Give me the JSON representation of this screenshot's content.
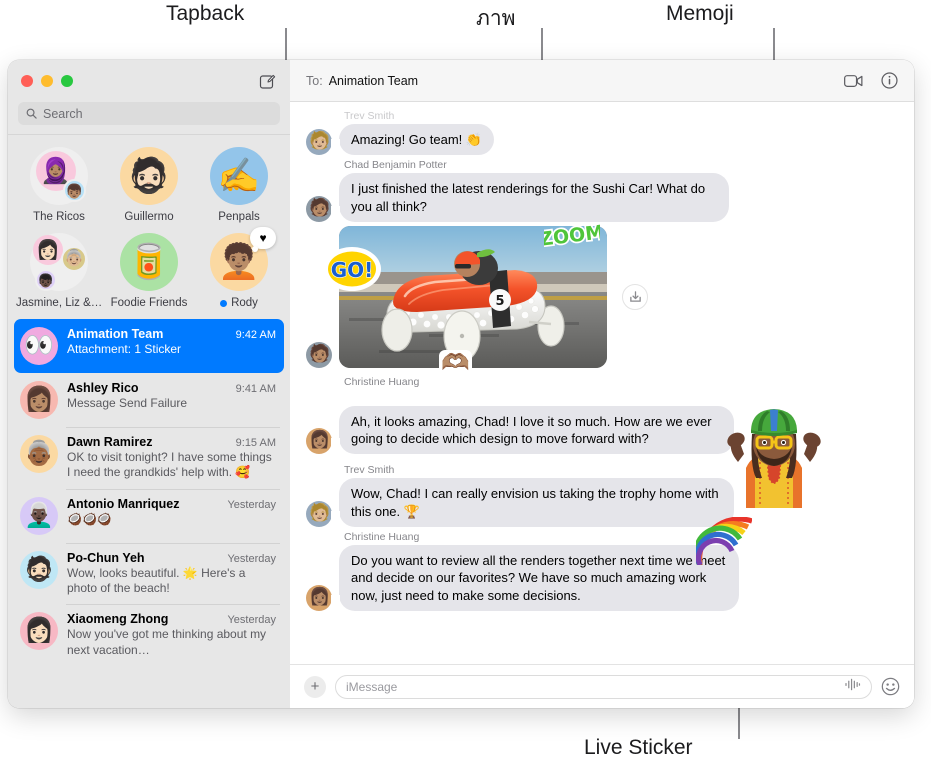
{
  "annotations": [
    {
      "id": "tapback",
      "label": "Tapback"
    },
    {
      "id": "image",
      "label": "ภาพ"
    },
    {
      "id": "memoji",
      "label": "Memoji"
    },
    {
      "id": "live_sticker",
      "label": "Live Sticker"
    }
  ],
  "window": {
    "traffic_lights": {
      "close": "close-button",
      "minimize": "minimize-button",
      "zoom": "zoom-button"
    },
    "compose_label": "compose-icon"
  },
  "sidebar": {
    "search": {
      "placeholder": "Search"
    },
    "pinned": [
      {
        "name": "The Ricos",
        "type": "group",
        "unread": false,
        "tapback": null
      },
      {
        "name": "Guillermo",
        "type": "memoji",
        "unread": false,
        "tapback": null
      },
      {
        "name": "Penpals",
        "type": "emoji",
        "unread": false,
        "tapback": null
      },
      {
        "name": "Jasmine, Liz &…",
        "type": "group",
        "unread": false,
        "tapback": null
      },
      {
        "name": "Foodie Friends",
        "type": "emoji",
        "unread": false,
        "tapback": null
      },
      {
        "name": "Rody",
        "type": "memoji",
        "unread": true,
        "tapback": "♥"
      }
    ],
    "conversations": [
      {
        "name": "Animation Team",
        "time": "9:42 AM",
        "preview": "Attachment: 1 Sticker",
        "selected": true
      },
      {
        "name": "Ashley Rico",
        "time": "9:41 AM",
        "preview": "Message Send Failure",
        "selected": false
      },
      {
        "name": "Dawn Ramirez",
        "time": "9:15 AM",
        "preview": "OK to visit tonight? I have some things I need the grandkids' help with. 🥰",
        "selected": false
      },
      {
        "name": "Antonio Manriquez",
        "time": "Yesterday",
        "preview": "🥥🥥🥥",
        "selected": false
      },
      {
        "name": "Po-Chun Yeh",
        "time": "Yesterday",
        "preview": "Wow, looks beautiful. 🌟 Here's a photo of the beach!",
        "selected": false
      },
      {
        "name": "Xiaomeng Zhong",
        "time": "Yesterday",
        "preview": "Now you've got me thinking about my next vacation…",
        "selected": false
      }
    ]
  },
  "chat": {
    "to_label": "To:",
    "recipient": "Animation Team",
    "facetime_label": "facetime-video-icon",
    "info_label": "info-icon",
    "messages": [
      {
        "sender": "Trev Smith",
        "text": "Amazing! Go team! 👏",
        "type": "text"
      },
      {
        "sender": "Chad Benjamin Potter",
        "text": "I just finished the latest renderings for the Sushi Car! What do you all think?",
        "type": "text"
      },
      {
        "sender": "",
        "text": "",
        "type": "photo",
        "photo_stickers": [
          "GO!",
          "ZOOM",
          "🫶"
        ],
        "save_label": "save-attachment-icon"
      },
      {
        "sender": "Christine Huang",
        "text": "Ah, it looks amazing, Chad! I love it so much. How are we ever going to decide which design to move forward with?",
        "type": "text"
      },
      {
        "sender": "Trev Smith",
        "text": "Wow, Chad! I can really envision us taking the trophy home with this one. 🏆",
        "type": "text"
      },
      {
        "sender": "Christine Huang",
        "text": "Do you want to review all the renders together next time we meet and decide on our favorites? We have so much amazing work now, just need to make some decisions.",
        "type": "text"
      }
    ],
    "composer": {
      "add_label": "+",
      "placeholder": "iMessage",
      "audio_label": "audio-waveform-icon",
      "emoji_label": "emoji-picker-icon"
    }
  },
  "colors": {
    "accent": "#007aff",
    "bubble": "#e5e5ea",
    "sidebar": "#e7e7e7",
    "header": "#f6f6f6"
  }
}
